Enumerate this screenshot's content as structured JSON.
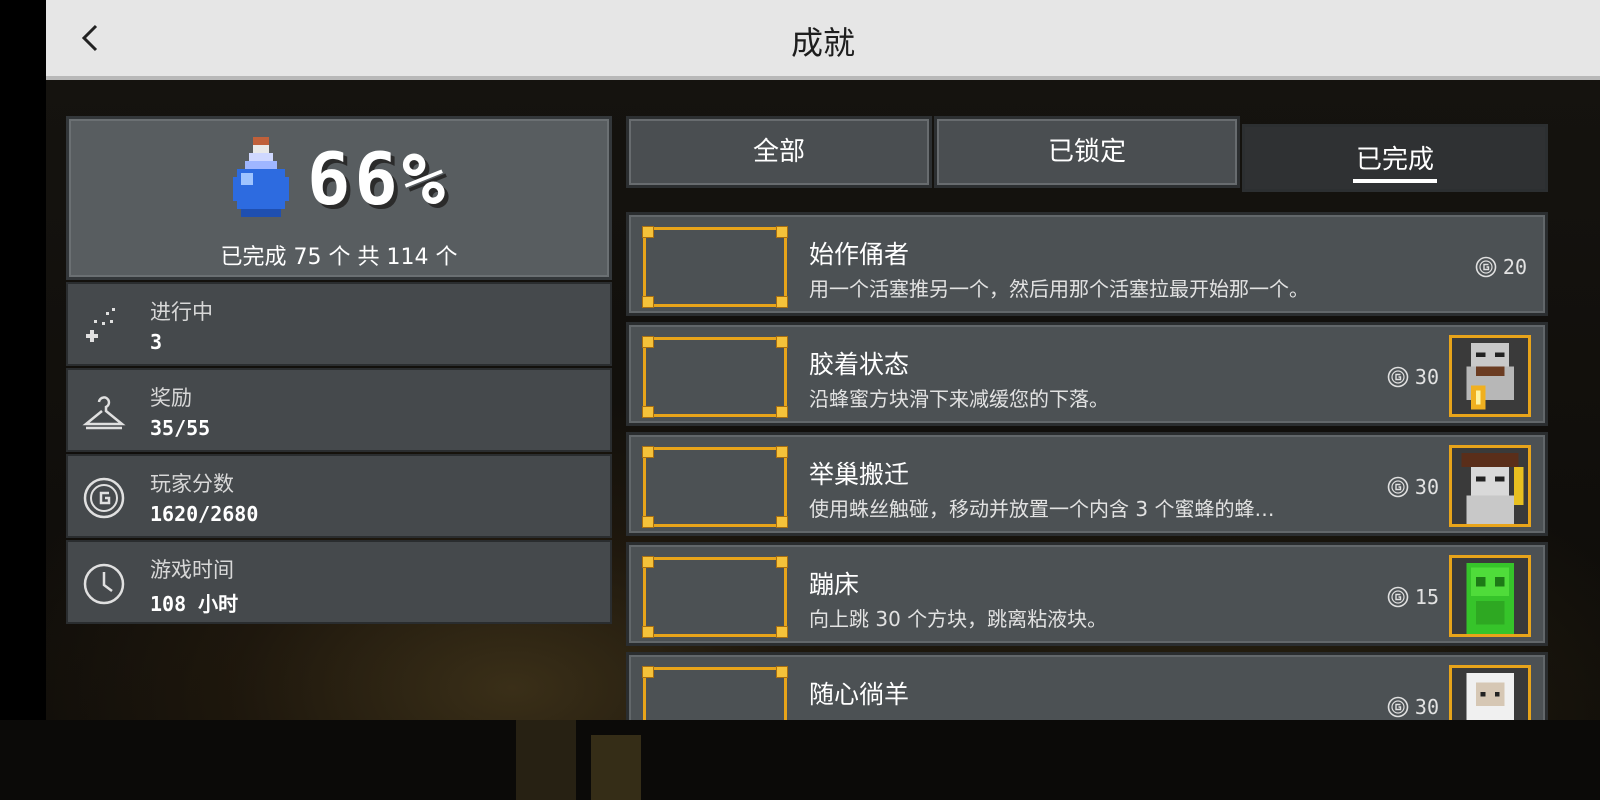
{
  "header": {
    "title": "成就",
    "back_icon": "chevron-left-icon"
  },
  "summary": {
    "percent": "66%",
    "completed_text": "已完成 75 个 共 114 个",
    "icon": "potion-icon"
  },
  "stats": [
    {
      "label": "进行中",
      "value": "3",
      "icon": "sparkle-icon"
    },
    {
      "label": "奖励",
      "value": "35/55",
      "icon": "hanger-icon"
    },
    {
      "label": "玩家分数",
      "value": "1620/2680",
      "icon": "gamerscore-icon"
    },
    {
      "label": "游戏时间",
      "value": "108 小时",
      "icon": "clock-icon"
    }
  ],
  "tabs": [
    {
      "label": "全部",
      "active": false
    },
    {
      "label": "已锁定",
      "active": false
    },
    {
      "label": "已完成",
      "active": true
    }
  ],
  "achievements": [
    {
      "title": "始作俑者",
      "desc": "用一个活塞推另一个，然后用那个活塞拉最开始那一个。",
      "score": "20",
      "has_reward": false
    },
    {
      "title": "胶着状态",
      "desc": "沿蜂蜜方块滑下来减缓您的下落。",
      "score": "30",
      "has_reward": true,
      "reward_icon": "armored-character-icon"
    },
    {
      "title": "举巢搬迁",
      "desc": "使用蛛丝触碰，移动并放置一个内含 3 个蜜蜂的蜂…",
      "score": "30",
      "has_reward": true,
      "reward_icon": "hat-character-icon"
    },
    {
      "title": "蹦床",
      "desc": "向上跳 30 个方块，跳离粘液块。",
      "score": "15",
      "has_reward": true,
      "reward_icon": "slime-character-icon"
    },
    {
      "title": "随心徜羊",
      "desc": "",
      "score": "30",
      "has_reward": true,
      "reward_icon": "sheep-character-icon"
    }
  ],
  "colors": {
    "accent_gold": "#e8a41a",
    "panel": "#4c5154",
    "header": "#e6e6e6"
  }
}
